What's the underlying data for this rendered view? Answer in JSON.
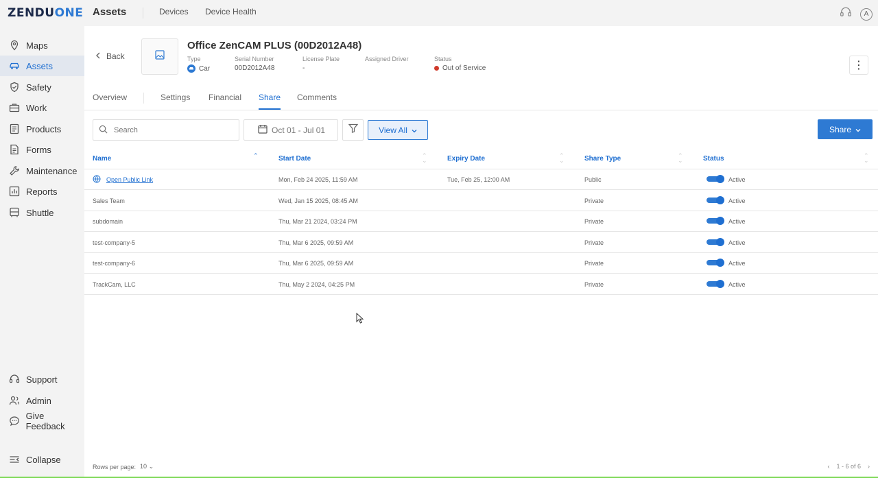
{
  "app": {
    "logo_part1": "ZENDU",
    "logo_part2": "ONE"
  },
  "topbar": {
    "title": "Assets",
    "tabs": [
      "Devices",
      "Device Health"
    ]
  },
  "sidebar": {
    "items": [
      {
        "label": "Maps",
        "icon": "map-pin-icon"
      },
      {
        "label": "Assets",
        "icon": "car-icon",
        "active": true
      },
      {
        "label": "Safety",
        "icon": "shield-icon"
      },
      {
        "label": "Work",
        "icon": "briefcase-icon"
      },
      {
        "label": "Products",
        "icon": "product-icon"
      },
      {
        "label": "Forms",
        "icon": "document-icon"
      },
      {
        "label": "Maintenance",
        "icon": "wrench-icon"
      },
      {
        "label": "Reports",
        "icon": "chart-icon"
      },
      {
        "label": "Shuttle",
        "icon": "bus-icon"
      }
    ],
    "bottom": [
      {
        "label": "Support",
        "icon": "headset-icon"
      },
      {
        "label": "Admin",
        "icon": "users-icon"
      },
      {
        "label": "Give Feedback",
        "icon": "chat-icon"
      },
      {
        "label": "Collapse",
        "icon": "collapse-icon"
      }
    ]
  },
  "asset": {
    "back_label": "Back",
    "title": "Office ZenCAM PLUS (00D2012A48)",
    "type_label": "Type",
    "type_value": "Car",
    "serial_label": "Serial Number",
    "serial_value": "00D2012A48",
    "plate_label": "License Plate",
    "plate_value": "-",
    "driver_label": "Assigned Driver",
    "status_label": "Status",
    "status_value": "Out of Service",
    "status_color": "#d03a2b"
  },
  "tabs": [
    "Overview",
    "Settings",
    "Financial",
    "Share",
    "Comments"
  ],
  "active_tab": "Share",
  "toolbar": {
    "search_placeholder": "Search",
    "date_range": "Oct 01 - Jul 01",
    "view_all": "View All",
    "share": "Share"
  },
  "table": {
    "columns": [
      "Name",
      "Start Date",
      "Expiry Date",
      "Share Type",
      "Status"
    ],
    "rows": [
      {
        "name": "Open Public Link",
        "start": "Mon, Feb 24 2025, 11:59 AM",
        "expiry": "Tue, Feb 25, 12:00 AM",
        "type": "Public",
        "status": "Active"
      },
      {
        "name": "Sales Team",
        "start": "Wed, Jan 15 2025, 08:45 AM",
        "expiry": "",
        "type": "Private",
        "status": "Active"
      },
      {
        "name": "subdomain",
        "start": "Thu, Mar 21 2024, 03:24 PM",
        "expiry": "",
        "type": "Private",
        "status": "Active"
      },
      {
        "name": "test-company-5",
        "start": "Thu, Mar 6 2025, 09:59 AM",
        "expiry": "",
        "type": "Private",
        "status": "Active"
      },
      {
        "name": "test-company-6",
        "start": "Thu, Mar 6 2025, 09:59 AM",
        "expiry": "",
        "type": "Private",
        "status": "Active"
      },
      {
        "name": "TrackCam, LLC",
        "start": "Thu, May 2 2024, 04:25 PM",
        "expiry": "",
        "type": "Private",
        "status": "Active"
      }
    ]
  },
  "pagination": {
    "rows_label": "Rows per page:",
    "rows_value": "10",
    "range": "1 - 6 of 6"
  },
  "colors": {
    "accent": "#2e7ad3",
    "active_nav_bg": "#e2e7ef"
  }
}
